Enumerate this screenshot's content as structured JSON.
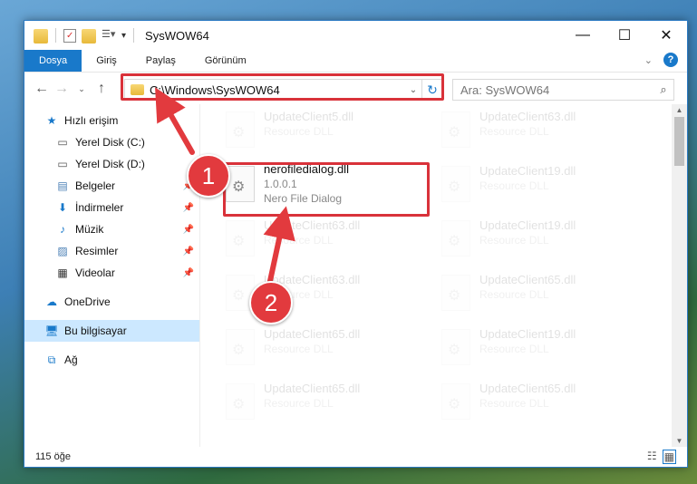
{
  "window": {
    "title": "SysWOW64"
  },
  "window_controls": {
    "minimize": "—",
    "maximize": "☐",
    "close": "✕"
  },
  "ribbon": {
    "tabs": [
      "Dosya",
      "Giriş",
      "Paylaş",
      "Görünüm"
    ],
    "active_tab": "Dosya",
    "help": "?"
  },
  "address": {
    "path": "C:\\Windows\\SysWOW64"
  },
  "search": {
    "placeholder": "Ara: SysWOW64"
  },
  "sidebar": {
    "items": [
      {
        "label": "Hızlı erişim",
        "icon": "star-icon"
      },
      {
        "label": "Yerel Disk (C:)",
        "icon": "drive-icon"
      },
      {
        "label": "Yerel Disk (D:)",
        "icon": "drive-icon"
      },
      {
        "label": "Belgeler",
        "icon": "document-icon"
      },
      {
        "label": "İndirmeler",
        "icon": "download-icon"
      },
      {
        "label": "Müzik",
        "icon": "music-icon"
      },
      {
        "label": "Resimler",
        "icon": "pictures-icon"
      },
      {
        "label": "Videolar",
        "icon": "video-icon"
      },
      {
        "label": "OneDrive",
        "icon": "cloud-icon"
      },
      {
        "label": "Bu bilgisayar",
        "icon": "computer-icon"
      },
      {
        "label": "Ağ",
        "icon": "network-icon"
      }
    ]
  },
  "files": {
    "highlighted": {
      "name": "nerofiledialog.dll",
      "version": "1.0.0.1",
      "description": "Nero File Dialog"
    },
    "faded": [
      {
        "name": "UpdateClient5.dll",
        "sub": "Resource DLL"
      },
      {
        "name": "UpdateClient63.dll",
        "sub": "Resource DLL"
      },
      {
        "name": "UpdateClient19.dll",
        "sub": "Resource DLL"
      },
      {
        "name": "UpdateClient63.dll",
        "sub": "Resource DLL"
      },
      {
        "name": "UpdateClient19.dll",
        "sub": "Resource DLL"
      },
      {
        "name": "UpdateClient63.dll",
        "sub": "Resource DLL"
      },
      {
        "name": "UpdateClient65.dll",
        "sub": "Resource DLL"
      },
      {
        "name": "UpdateClient65.dll",
        "sub": "Resource DLL"
      },
      {
        "name": "UpdateClient19.dll",
        "sub": "Resource DLL"
      },
      {
        "name": "UpdateClient65.dll",
        "sub": "Resource DLL"
      },
      {
        "name": "UpdateClient65.dll",
        "sub": "Resource DLL"
      }
    ]
  },
  "status": {
    "count": "115 öğe"
  },
  "annotations": {
    "step1": "1",
    "step2": "2",
    "highlight_color": "#d9323a"
  }
}
